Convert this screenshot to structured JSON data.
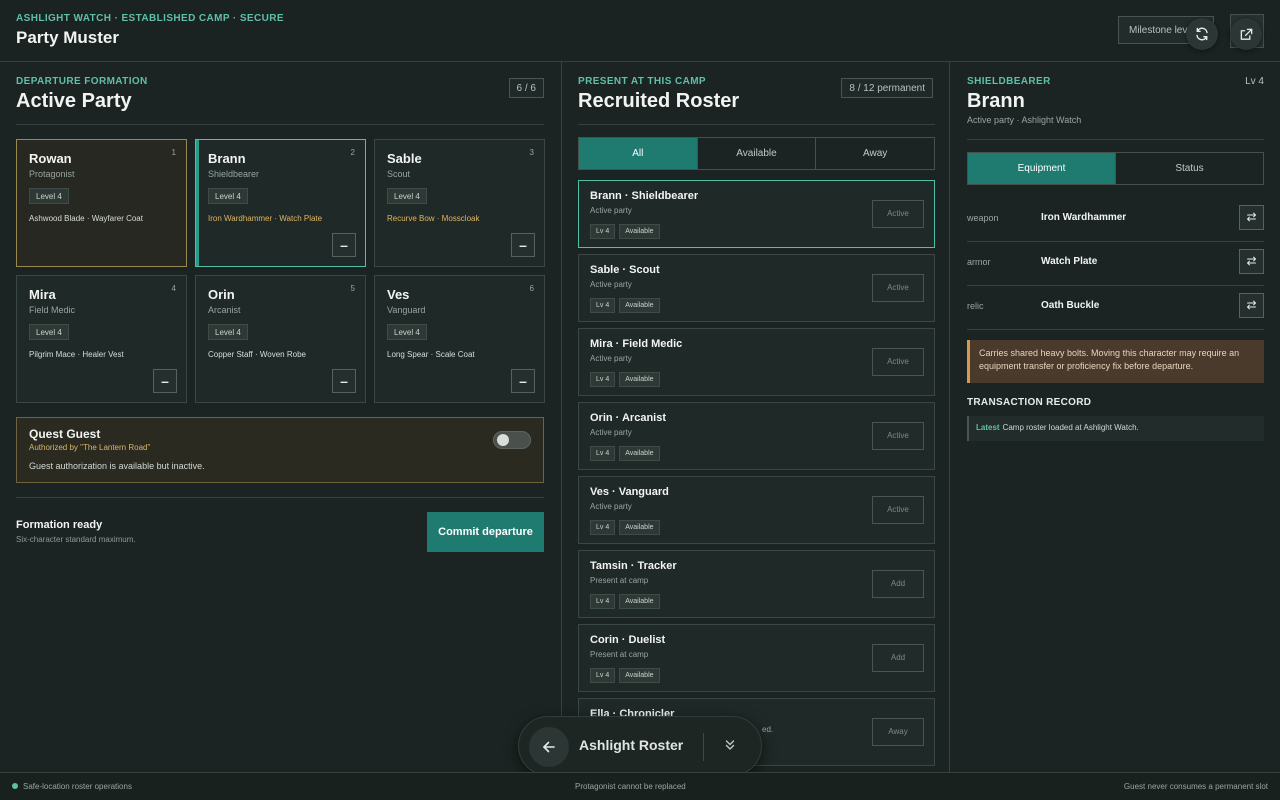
{
  "header": {
    "eyebrow": "ASHLIGHT WATCH · ESTABLISHED CAMP · SECURE",
    "title": "Party Muster",
    "milestone_label": "Milestone leve"
  },
  "active_party": {
    "eyebrow": "DEPARTURE FORMATION",
    "title": "Active Party",
    "count": "6 / 6",
    "members": [
      {
        "slot": "1",
        "name": "Rowan",
        "role": "Protagonist",
        "level": "Level 4",
        "gear": "Ashwood Blade · Wayfarer Coat"
      },
      {
        "slot": "2",
        "name": "Brann",
        "role": "Shieldbearer",
        "level": "Level 4",
        "gear": "Iron Wardhammer · Watch Plate",
        "remove": "–"
      },
      {
        "slot": "3",
        "name": "Sable",
        "role": "Scout",
        "level": "Level 4",
        "gear": "Recurve Bow · Mosscloak",
        "remove": "–"
      },
      {
        "slot": "4",
        "name": "Mira",
        "role": "Field Medic",
        "level": "Level 4",
        "gear": "Pilgrim Mace · Healer Vest",
        "remove": "–"
      },
      {
        "slot": "5",
        "name": "Orin",
        "role": "Arcanist",
        "level": "Level 4",
        "gear": "Copper Staff · Woven Robe",
        "remove": "–"
      },
      {
        "slot": "6",
        "name": "Ves",
        "role": "Vanguard",
        "level": "Level 4",
        "gear": "Long Spear · Scale Coat",
        "remove": "–"
      }
    ],
    "guest": {
      "title": "Quest Guest",
      "authorized": "Authorized by \"The Lantern Road\"",
      "status": "Guest authorization is available but inactive."
    },
    "ready_title": "Formation ready",
    "ready_sub": "Six-character standard maximum.",
    "commit_label": "Commit departure"
  },
  "roster": {
    "eyebrow": "PRESENT AT THIS CAMP",
    "title": "Recruited Roster",
    "count": "8 / 12 permanent",
    "tabs": [
      {
        "label": "All"
      },
      {
        "label": "Available"
      },
      {
        "label": "Away"
      }
    ],
    "rows": [
      {
        "name": "Brann · Shieldbearer",
        "sub": "Active party",
        "lv": "Lv 4",
        "status": "Available",
        "action": "Active"
      },
      {
        "name": "Sable · Scout",
        "sub": "Active party",
        "lv": "Lv 4",
        "status": "Available",
        "action": "Active"
      },
      {
        "name": "Mira · Field Medic",
        "sub": "Active party",
        "lv": "Lv 4",
        "status": "Available",
        "action": "Active"
      },
      {
        "name": "Orin · Arcanist",
        "sub": "Active party",
        "lv": "Lv 4",
        "status": "Available",
        "action": "Active"
      },
      {
        "name": "Ves · Vanguard",
        "sub": "Active party",
        "lv": "Lv 4",
        "status": "Available",
        "action": "Active"
      },
      {
        "name": "Tamsin · Tracker",
        "sub": "Present at camp",
        "lv": "Lv 4",
        "status": "Available",
        "action": "Add"
      },
      {
        "name": "Corin · Duelist",
        "sub": "Present at camp",
        "lv": "Lv 4",
        "status": "Available",
        "action": "Add"
      },
      {
        "name": "Ella · Chronicler",
        "sub": "ed.",
        "action": "Away"
      }
    ]
  },
  "detail": {
    "eyebrow": "SHIELDBEARER",
    "level": "Lv 4",
    "name": "Brann",
    "sub": "Active party · Ashlight Watch",
    "tabs": [
      {
        "label": "Equipment"
      },
      {
        "label": "Status"
      }
    ],
    "equipment": [
      {
        "slot": "weapon",
        "item": "Iron Wardhammer"
      },
      {
        "slot": "armor",
        "item": "Watch Plate"
      },
      {
        "slot": "relic",
        "item": "Oath Buckle"
      }
    ],
    "swap_glyph": "⇄",
    "warning": "Carries shared heavy bolts. Moving this character may require an equipment transfer or proficiency fix before departure.",
    "transaction_title": "TRANSACTION RECORD",
    "transaction_latest": "Latest",
    "transaction_text": "Camp roster loaded at Ashlight Watch."
  },
  "dock": {
    "title": "Ashlight Roster"
  },
  "footer": {
    "left": "Safe-location roster operations",
    "center": "Protagonist cannot be replaced",
    "right": "Guest never consumes a permanent slot"
  },
  "icons": [
    "refresh-icon",
    "external-link-icon",
    "arrow-left-icon",
    "chevrons-down-icon",
    "swap-icon"
  ],
  "colors": {
    "accent": "#1f7a70",
    "teal_text": "#5fbfa9",
    "warning": "#d49a4f",
    "gold_text": "#e0b561"
  }
}
